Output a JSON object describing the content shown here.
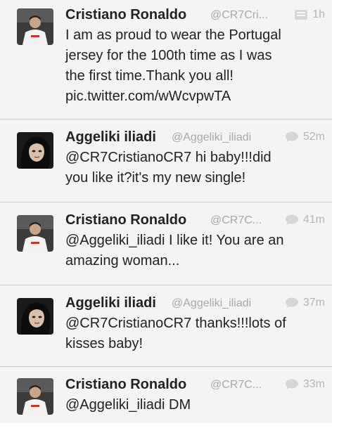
{
  "tweets": [
    {
      "name": "Cristiano Ronaldo",
      "handle": "@CR7Cri...",
      "meta_icon": "media-card-icon",
      "time": "1h",
      "text": "I am as proud to wear the Portugal\njersey for the 100th time as I was\nthe first time.Thank you all!\npic.twitter.com/wWcvpwTA"
    },
    {
      "name": "Aggeliki iliadi",
      "handle": "@Aggeliki_iliadi",
      "meta_icon": "reply-bubble-icon",
      "time": "52m",
      "text": "@CR7CristianoCR7 hi baby!!!did\nyou like it?it's my new single!"
    },
    {
      "name": "Cristiano Ronaldo",
      "handle": "@CR7C...",
      "meta_icon": "reply-bubble-icon",
      "time": "41m",
      "text": "@Aggeliki_iliadi I like it! You are an\namazing woman..."
    },
    {
      "name": "Aggeliki iliadi",
      "handle": "@Aggeliki_iliadi",
      "meta_icon": "reply-bubble-icon",
      "time": "37m",
      "text": "@CR7CristianoCR7 thanks!!!lots of\nkisses baby!"
    },
    {
      "name": "Cristiano Ronaldo",
      "handle": "@CR7C...",
      "meta_icon": "reply-bubble-icon",
      "time": "33m",
      "text": "@Aggeliki_iliadi DM"
    }
  ]
}
